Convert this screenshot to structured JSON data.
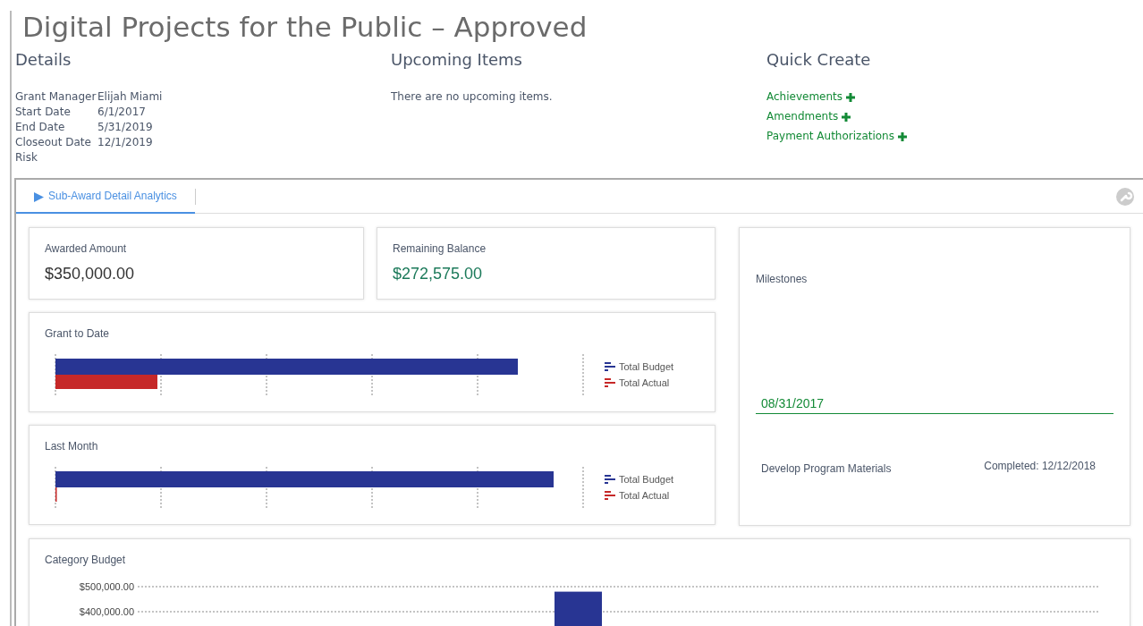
{
  "page_title": "Digital Projects for the Public – Approved",
  "details": {
    "heading": "Details",
    "fields": [
      {
        "label": "Grant Manager",
        "value": "Elijah Miami"
      },
      {
        "label": "Start Date",
        "value": "6/1/2017"
      },
      {
        "label": "End Date",
        "value": "5/31/2019"
      },
      {
        "label": "Closeout Date",
        "value": "12/1/2019"
      },
      {
        "label": "Risk"
      }
    ]
  },
  "upcoming": {
    "heading": "Upcoming Items",
    "message": "There are no upcoming items."
  },
  "quick_create": {
    "heading": "Quick Create",
    "links": [
      "Achievements",
      "Amendments",
      "Payment Authorizations"
    ]
  },
  "tabs": [
    {
      "label": "Sub-Award Detail Analytics",
      "selected": true
    }
  ],
  "awarded": {
    "label": "Awarded Amount",
    "value": "$350,000.00"
  },
  "remaining": {
    "label": "Remaining Balance",
    "value": "$272,575.00"
  },
  "bar_panels": [
    {
      "title": "Grant to Date",
      "legend": [
        "Total Budget",
        "Total Actual"
      ]
    },
    {
      "title": "Last Month",
      "legend": [
        "Total Budget",
        "Total Actual"
      ]
    }
  ],
  "milestones": {
    "title": "Milestones",
    "items": [
      {
        "date": "08/31/2017",
        "name": "Develop Program Materials",
        "status": "Completed: 12/12/2018"
      }
    ]
  },
  "category_budget": {
    "title": "Category Budget",
    "chart_data": {
      "type": "bar",
      "ylim": [
        0,
        500000
      ],
      "yticks": [
        {
          "value": 400000,
          "label": "$400,000.00"
        },
        {
          "value": 500000,
          "label": "$500,000.00"
        }
      ],
      "series": [
        {
          "color": "#283593",
          "values": [
            480000
          ]
        }
      ]
    }
  }
}
